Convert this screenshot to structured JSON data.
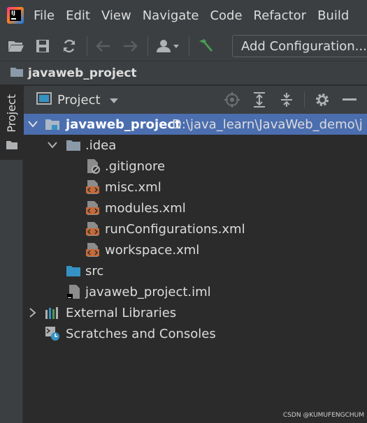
{
  "menubar": {
    "items": [
      {
        "label": "File"
      },
      {
        "label": "Edit"
      },
      {
        "label": "View"
      },
      {
        "label": "Navigate"
      },
      {
        "label": "Code"
      },
      {
        "label": "Refactor"
      },
      {
        "label": "Build"
      }
    ]
  },
  "toolbar": {
    "icons": [
      "open-folder-icon",
      "save-icon",
      "sync-icon",
      "back-arrow-icon",
      "forward-arrow-icon",
      "user-account-icon",
      "build-hammer-icon"
    ],
    "run_config_label": "Add Configuration..."
  },
  "breadcrumb": {
    "project": "javaweb_project"
  },
  "stripe": {
    "tab_label": "Project"
  },
  "panel": {
    "title": "Project",
    "actions": [
      "locate-icon",
      "expand-all-icon",
      "collapse-all-icon",
      "settings-gear-icon",
      "hide-minus-icon"
    ]
  },
  "tree": {
    "root": {
      "name": "javaweb_project",
      "path": "D:\\java_learn\\JavaWeb_demo\\j"
    },
    "idea": {
      "name": ".idea"
    },
    "files": [
      {
        "name": ".gitignore"
      },
      {
        "name": "misc.xml"
      },
      {
        "name": "modules.xml"
      },
      {
        "name": "runConfigurations.xml"
      },
      {
        "name": "workspace.xml"
      }
    ],
    "src": {
      "name": "src"
    },
    "iml": {
      "name": "javaweb_project.iml"
    },
    "external": {
      "name": "External Libraries"
    },
    "scratches": {
      "name": "Scratches and Consoles"
    }
  },
  "watermark": "CSDN @KUMUFENGCHUM",
  "colors": {
    "selection": "#4b6eaf",
    "panel_bg": "#2b2b2b",
    "chrome_bg": "#3c3f41",
    "folder": "#8a9aa8",
    "xml": "#c46b3a"
  }
}
